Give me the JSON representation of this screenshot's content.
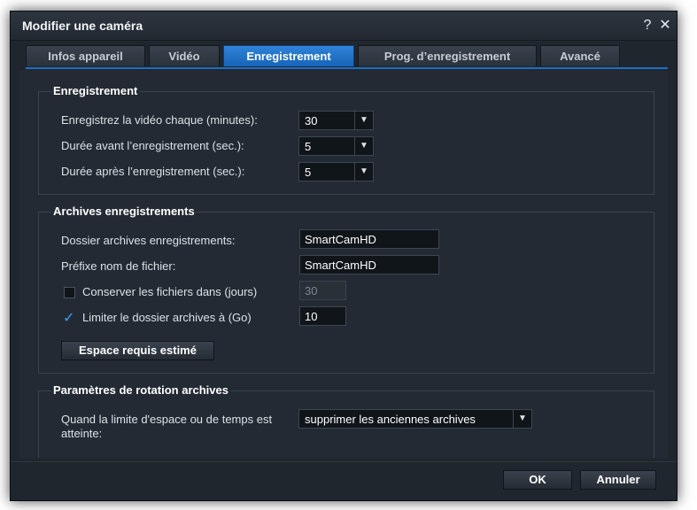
{
  "window": {
    "title": "Modifier une caméra",
    "help_glyph": "?",
    "close_glyph": "✕"
  },
  "tabs": [
    {
      "label": "Infos appareil",
      "active": false
    },
    {
      "label": "Vidéo",
      "active": false
    },
    {
      "label": "Enregistrement",
      "active": true
    },
    {
      "label": "Prog. d’enregistrement",
      "active": false
    },
    {
      "label": "Avancé",
      "active": false
    }
  ],
  "recording": {
    "title": "Enregistrement",
    "every_label": "Enregistrez la vidéo chaque (minutes):",
    "every_value": "30",
    "pre_label": "Durée avant l’enregistrement (sec.):",
    "pre_value": "5",
    "post_label": "Durée après l’enregistrement (sec.):",
    "post_value": "5"
  },
  "archive": {
    "title": "Archives enregistrements",
    "folder_label": "Dossier archives enregistrements:",
    "folder_value": "SmartCamHD",
    "prefix_label": "Préfixe nom de fichier:",
    "prefix_value": "SmartCamHD",
    "keep_label": "Conserver les fichiers dans (jours)",
    "keep_checked": false,
    "keep_value": "30",
    "limit_label": "Limiter le dossier archives à (Go)",
    "limit_checked": true,
    "limit_value": "10",
    "estimate_button": "Espace requis estimé"
  },
  "rotation": {
    "title": "Paramètres de rotation archives",
    "when_label_line1": "Quand la limite d'espace ou de temps est",
    "when_label_line2": "atteinte:",
    "action_value": "supprimer les anciennes archives"
  },
  "footer": {
    "ok": "OK",
    "cancel": "Annuler"
  },
  "icons": {
    "dropdown": "chevron-down-icon",
    "check": "checkmark-icon"
  },
  "colors": {
    "accent": "#1f6fc5",
    "check": "#3d9bff",
    "background": "#1f262e"
  }
}
